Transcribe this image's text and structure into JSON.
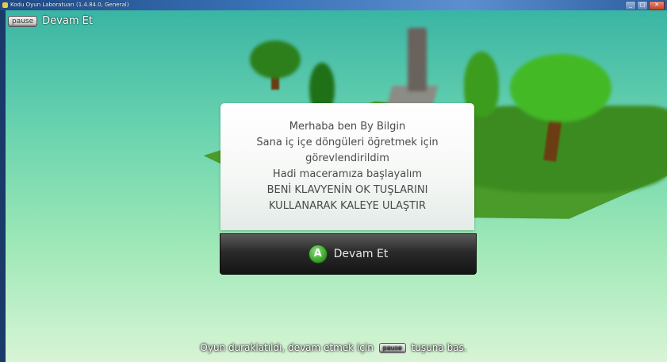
{
  "window": {
    "title": "Kodu Oyun Laboratuarı (1.4.84.0, General)",
    "controls": [
      "_",
      "□",
      "✕"
    ]
  },
  "top_hint": {
    "key_label": "pause",
    "label": "Devam Et"
  },
  "dialog": {
    "lines": [
      "Merhaba ben By Bilgin",
      "Sana iç içe döngüleri öğretmek için",
      "görevlendirildim",
      "Hadi maceramıza başlayalım",
      "BENİ KLAVYENİN OK TUŞLARINI",
      "KULLANARAK KALEYE ULAŞTIR"
    ],
    "button_glyph": "A",
    "button_label": "Devam Et"
  },
  "bottom_hint": {
    "before": "Oyun duraklatıldı, devam etmek için",
    "key_label": "pause",
    "after": "tuşuna bas."
  },
  "colors": {
    "sky_top": "#3fb4a4",
    "sky_bottom": "#d9f4d6",
    "ground": "#4d9a2d",
    "a_button": "#3da52b",
    "continue_bar": "#1a1a1a"
  }
}
